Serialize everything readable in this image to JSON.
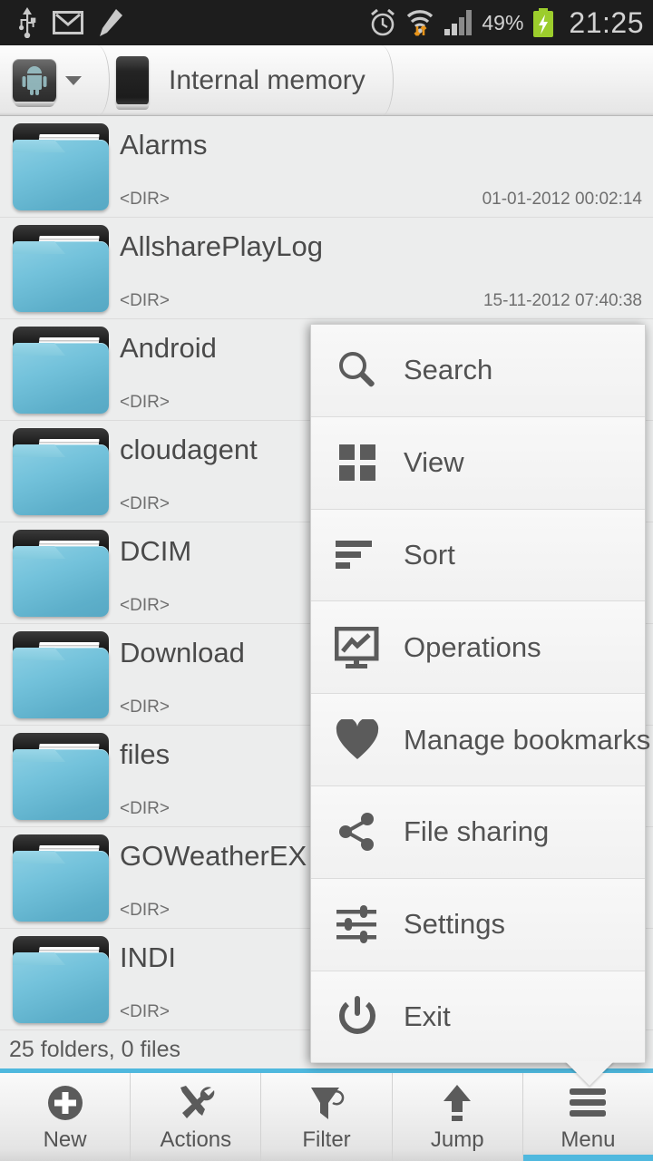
{
  "statusbar": {
    "icons_left": [
      "usb-icon",
      "gmail-icon",
      "pencil-icon"
    ],
    "icons_right": [
      "alarm-icon",
      "wifi-icon",
      "signal-icon",
      "battery-charging-icon"
    ],
    "battery_percent": "49%",
    "time": "21:25",
    "bg_color": "#1d1d1d",
    "text_color": "#d2d2d2"
  },
  "breadcrumb": {
    "root_icon": "android-robot-icon",
    "dropdown_icon": "chevron-down-icon",
    "device_icon": "phone-icon",
    "label": "Internal memory"
  },
  "filelist": {
    "dir_marker": "<DIR>",
    "rows": [
      {
        "name": "Alarms",
        "type": "<DIR>",
        "date": "01-01-2012 00:02:14"
      },
      {
        "name": "AllsharePlayLog",
        "type": "<DIR>",
        "date": "15-11-2012 07:40:38"
      },
      {
        "name": "Android",
        "type": "<DIR>",
        "date": ""
      },
      {
        "name": "cloudagent",
        "type": "<DIR>",
        "date": ""
      },
      {
        "name": "DCIM",
        "type": "<DIR>",
        "date": ""
      },
      {
        "name": "Download",
        "type": "<DIR>",
        "date": ""
      },
      {
        "name": "files",
        "type": "<DIR>",
        "date": ""
      },
      {
        "name": "GOWeatherEX",
        "type": "<DIR>",
        "date": ""
      },
      {
        "name": "INDI",
        "type": "<DIR>",
        "date": ""
      }
    ]
  },
  "summary": {
    "text": "25 folders, 0 files",
    "accent_color": "#4fb8de"
  },
  "toolbar": {
    "items": [
      {
        "label": "New",
        "icon": "plus-circle-icon",
        "active": false
      },
      {
        "label": "Actions",
        "icon": "tools-icon",
        "active": false
      },
      {
        "label": "Filter",
        "icon": "funnel-icon",
        "active": false
      },
      {
        "label": "Jump",
        "icon": "arrow-up-icon",
        "active": false
      },
      {
        "label": "Menu",
        "icon": "hamburger-icon",
        "active": true
      }
    ]
  },
  "popup_menu": {
    "items": [
      {
        "label": "Search",
        "icon": "magnifier-icon"
      },
      {
        "label": "View",
        "icon": "grid-icon"
      },
      {
        "label": "Sort",
        "icon": "sort-bars-icon"
      },
      {
        "label": "Operations",
        "icon": "monitor-chart-icon"
      },
      {
        "label": "Manage bookmarks",
        "icon": "heart-icon"
      },
      {
        "label": "File sharing",
        "icon": "share-nodes-icon"
      },
      {
        "label": "Settings",
        "icon": "sliders-icon"
      },
      {
        "label": "Exit",
        "icon": "power-icon"
      }
    ]
  },
  "colors": {
    "folder_blue": "#73c2db",
    "accent": "#4fb8de",
    "page_bg": "#eceded",
    "menu_text": "#525252"
  }
}
